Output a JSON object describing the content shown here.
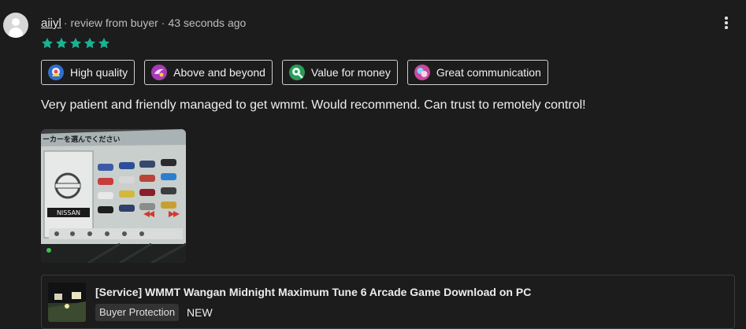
{
  "review": {
    "username": "aiiyl",
    "separator": "·",
    "source": "review from buyer",
    "separator2": "·",
    "time": "43 seconds ago",
    "rating": 5,
    "star_color": "#19b394",
    "tags": [
      {
        "label": "High quality",
        "icon": "high-quality-icon",
        "color": "#3a7bd5"
      },
      {
        "label": "Above and beyond",
        "icon": "above-and-beyond-icon",
        "color": "#b03fb8"
      },
      {
        "label": "Value for money",
        "icon": "value-for-money-icon",
        "color": "#2e9e5b"
      },
      {
        "label": "Great communication",
        "icon": "great-communication-icon",
        "color": "#d14fa3"
      }
    ],
    "text": "Very patient and friendly managed to get wmmt. Would recommend. Can trust to remotely control!",
    "photo": {
      "banner": "ーカーを選んでください",
      "brand": "NISSAN"
    }
  },
  "product": {
    "title": "[Service] WMMT Wangan Midnight Maximum Tune 6 Arcade Game Download on PC",
    "badge": "Buyer Protection",
    "condition": "NEW"
  },
  "icons": {
    "menu": "vertical-ellipsis-icon",
    "avatar": "user-avatar-icon",
    "star": "star-icon"
  }
}
